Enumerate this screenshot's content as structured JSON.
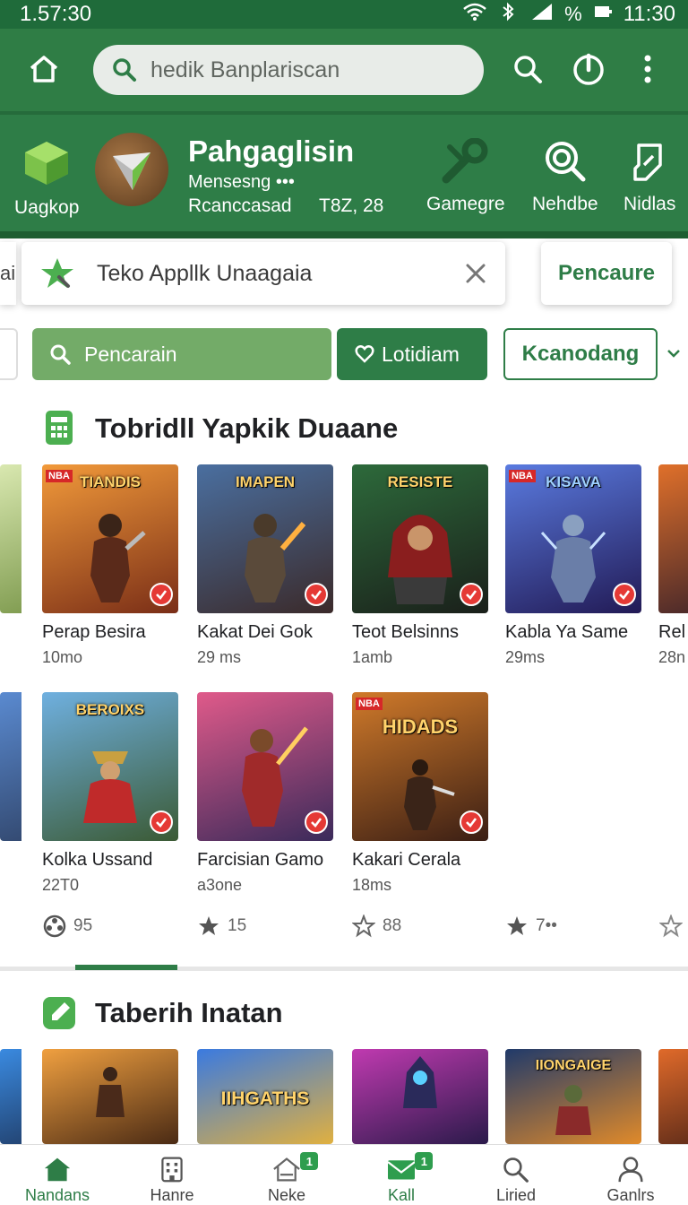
{
  "status": {
    "left_time": "1.57:30",
    "battery_pct": "%",
    "right_time": "11:30"
  },
  "search": {
    "placeholder": "hedik Banplariscan"
  },
  "banner": {
    "left_app_label": "Uagkop",
    "featured_title": "Pahgaglisin",
    "featured_subtitle": "Mensesng •••",
    "featured_category": "Rcanccasad",
    "featured_size": "T8Z, 28",
    "shortcuts": [
      {
        "label": "Gamegre",
        "icon": "wrench-icon"
      },
      {
        "label": "Nehdbe",
        "icon": "scan-icon"
      },
      {
        "label": "Nidlas",
        "icon": "edit-icon"
      }
    ]
  },
  "notice": {
    "peek_text": "ai",
    "text": "Teko Appllk Unaagaia",
    "action_label": "Pencaure"
  },
  "filters": {
    "search_label": "Pencarain",
    "favorite_label": "Lotidiam",
    "dropdown_label": "Kcanodang"
  },
  "sections": [
    {
      "title": "Tobridll Yapkik Duaane",
      "row1": [
        {
          "name": "Perap Besira",
          "meta": "10mo",
          "art_title": "TIANDIS",
          "badge": "NBA",
          "palette": [
            "#f29a3a",
            "#7a2e17"
          ]
        },
        {
          "name": "Kakat Dei Gok",
          "meta": "29 ms",
          "art_title": "IMAPEN",
          "badge": "",
          "palette": [
            "#4a6fa0",
            "#3b2a2a"
          ]
        },
        {
          "name": "Teot Belsinns",
          "meta": "1amb",
          "art_title": "RESISTE",
          "badge": "",
          "palette": [
            "#2d6a3b",
            "#1a1f1a"
          ]
        },
        {
          "name": "Kabla Ya Same",
          "meta": "29ms",
          "art_title": "KISAVA",
          "badge": "NBA",
          "palette": [
            "#5a7be0",
            "#221a55"
          ]
        }
      ],
      "row1_peek_right": {
        "name": "Rel",
        "meta": "28n"
      },
      "row2": [
        {
          "name": "Kolka Ussand",
          "meta": "22T0",
          "art_title": "BEROIXS",
          "badge": "",
          "palette": [
            "#6fb0e0",
            "#3b5a34"
          ]
        },
        {
          "name": "Farcisian Gamo",
          "meta": "a3one",
          "art_title": "",
          "badge": "",
          "palette": [
            "#e05a8a",
            "#3a2a5a"
          ]
        },
        {
          "name": "Kakari Cerala",
          "meta": "18ms",
          "art_title": "HIDADS",
          "badge": "NBA",
          "palette": [
            "#d07a2a",
            "#3a1e14"
          ]
        }
      ],
      "ratings": [
        {
          "icon": "reel-icon",
          "value": "95"
        },
        {
          "icon": "star-filled-icon",
          "value": "15"
        },
        {
          "icon": "star-outline-icon",
          "value": "88"
        },
        {
          "icon": "star-filled-icon",
          "value": "7••"
        },
        {
          "icon": "star-outline-icon",
          "value": ""
        }
      ]
    },
    {
      "title": "Taberih Inatan",
      "row1": [
        {
          "art_title": "",
          "palette": [
            "#f0a040",
            "#4a2a14"
          ]
        },
        {
          "art_title": "IIHGATHS",
          "palette": [
            "#3a7ae0",
            "#e0b040"
          ]
        },
        {
          "art_title": "",
          "palette": [
            "#c03ab0",
            "#2a1a4a"
          ]
        },
        {
          "art_title": "IIONGAIGE",
          "palette": [
            "#203a6a",
            "#e08a2a"
          ]
        }
      ]
    }
  ],
  "bottom_nav": [
    {
      "label": "Nandans",
      "icon": "home-icon",
      "badge": "",
      "active": true
    },
    {
      "label": "Hanre",
      "icon": "building-icon",
      "badge": "",
      "active": false
    },
    {
      "label": "Neke",
      "icon": "house-icon",
      "badge": "1",
      "active": false
    },
    {
      "label": "Kall",
      "icon": "mail-icon",
      "badge": "1",
      "active": true
    },
    {
      "label": "Liried",
      "icon": "search-icon",
      "badge": "",
      "active": false
    },
    {
      "label": "Ganlrs",
      "icon": "person-icon",
      "badge": "",
      "active": false
    }
  ],
  "colors": {
    "primary": "#2e7d47",
    "primary_dark": "#1f6b3a",
    "accent_light": "#73ab68",
    "check": "#e53935"
  }
}
